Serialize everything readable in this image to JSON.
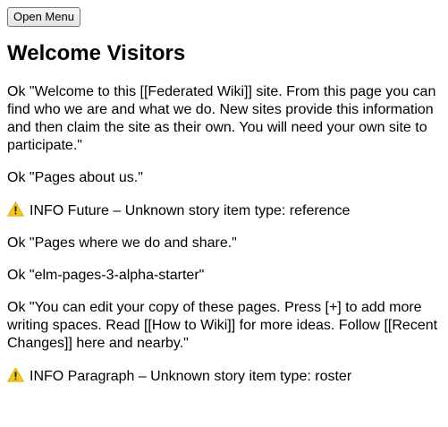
{
  "menu": {
    "open_label": "Open Menu"
  },
  "page": {
    "title": "Welcome Visitors"
  },
  "story": [
    {
      "kind": "paragraph",
      "text": "Ok \"Welcome to this [[Federated Wiki]] site. From this page you can find who we are and what we do. New sites provide this information and then claim the site as their own. You will need your own site to participate.\""
    },
    {
      "kind": "paragraph",
      "text": "Ok \"Pages about us.\""
    },
    {
      "kind": "warning",
      "icon": "warning-icon",
      "text": "INFO Future – Unknown story item type: reference"
    },
    {
      "kind": "paragraph",
      "text": "Ok \"Pages where we do and share.\""
    },
    {
      "kind": "paragraph",
      "text": "Ok \"elm-pages-3-alpha-starter\""
    },
    {
      "kind": "paragraph",
      "text": "Ok \"You can edit your copy of these pages. Press [+] to add more writing spaces. Read [[How to Wiki]] for more ideas. Follow [[Recent Changes]] here and nearby.\""
    },
    {
      "kind": "warning",
      "icon": "warning-icon",
      "text": "INFO Paragraph – Unknown story item type: roster"
    }
  ],
  "colors": {
    "warning_fill": "#f5c518",
    "warning_mark": "#1a1a1a"
  }
}
